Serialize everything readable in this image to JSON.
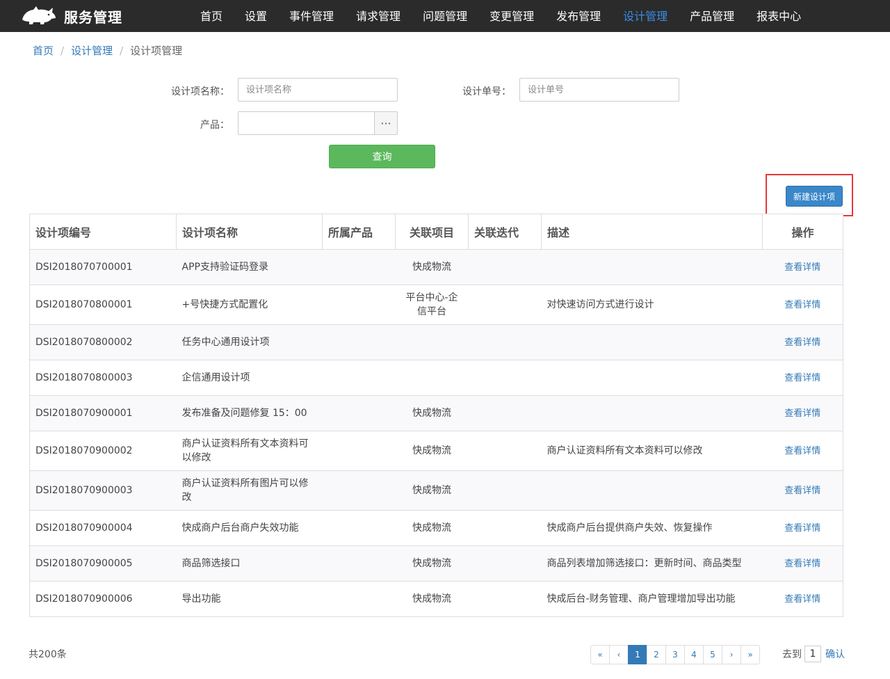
{
  "app": {
    "title": "服务管理",
    "logo_icon": "rhino-logo-icon"
  },
  "nav": {
    "items": [
      {
        "label": "首页"
      },
      {
        "label": "设置"
      },
      {
        "label": "事件管理"
      },
      {
        "label": "请求管理"
      },
      {
        "label": "问题管理"
      },
      {
        "label": "变更管理"
      },
      {
        "label": "发布管理"
      },
      {
        "label": "设计管理"
      },
      {
        "label": "产品管理"
      },
      {
        "label": "报表中心"
      }
    ],
    "active_index": 7,
    "active_color": "#3a8ee6"
  },
  "breadcrumb": {
    "home": "首页",
    "section": "设计管理",
    "current": "设计项管理",
    "separator": "/"
  },
  "search": {
    "name_label": "设计项名称：",
    "name_placeholder": "设计项名称",
    "name_value": "",
    "number_label": "设计单号：",
    "number_placeholder": "设计单号",
    "number_value": "",
    "product_label": "产品：",
    "product_value": "",
    "picker_label": "···",
    "query_label": "查询"
  },
  "toolbar": {
    "new_label": "新建设计项"
  },
  "table": {
    "headers": [
      "设计项编号",
      "设计项名称",
      "所属产品",
      "关联项目",
      "关联迭代",
      "描述",
      "操作"
    ],
    "action_label": "查看详情",
    "rows": [
      {
        "id": "DSI2018070700001",
        "name": "APP支持验证码登录",
        "product": "",
        "project": "快成物流",
        "iteration": "",
        "desc": ""
      },
      {
        "id": "DSI2018070800001",
        "name": "+号快捷方式配置化",
        "product": "",
        "project": "平台中心-企信平台",
        "iteration": "",
        "desc": "对快速访问方式进行设计"
      },
      {
        "id": "DSI2018070800002",
        "name": "任务中心通用设计项",
        "product": "",
        "project": "",
        "iteration": "",
        "desc": ""
      },
      {
        "id": "DSI2018070800003",
        "name": "企信通用设计项",
        "product": "",
        "project": "",
        "iteration": "",
        "desc": ""
      },
      {
        "id": "DSI2018070900001",
        "name": "发布准备及问题修复 15：00",
        "product": "",
        "project": "快成物流",
        "iteration": "",
        "desc": ""
      },
      {
        "id": "DSI2018070900002",
        "name": "商户认证资料所有文本资料可以修改",
        "product": "",
        "project": "快成物流",
        "iteration": "",
        "desc": "商户认证资料所有文本资料可以修改"
      },
      {
        "id": "DSI2018070900003",
        "name": "商户认证资料所有图片可以修改",
        "product": "",
        "project": "快成物流",
        "iteration": "",
        "desc": ""
      },
      {
        "id": "DSI2018070900004",
        "name": "快成商户后台商户失效功能",
        "product": "",
        "project": "快成物流",
        "iteration": "",
        "desc": "快成商户后台提供商户失效、恢复操作"
      },
      {
        "id": "DSI2018070900005",
        "name": "商品筛选接口",
        "product": "",
        "project": "快成物流",
        "iteration": "",
        "desc": "商品列表增加筛选接口：更新时间、商品类型"
      },
      {
        "id": "DSI2018070900006",
        "name": "导出功能",
        "product": "",
        "project": "快成物流",
        "iteration": "",
        "desc": "快成后台-财务管理、商户管理增加导出功能"
      }
    ]
  },
  "footer": {
    "total": "共200条",
    "pager": [
      "«",
      "‹",
      "1",
      "2",
      "3",
      "4",
      "5",
      "›",
      "»"
    ],
    "current_page": "1",
    "goto_label": "去到",
    "goto_value": "1",
    "confirm_label": "确认"
  }
}
